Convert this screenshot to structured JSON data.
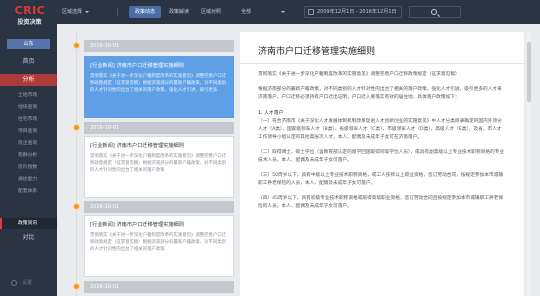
{
  "logo": {
    "brand": "CRIC",
    "subtitle": "投资决策"
  },
  "sidebar": {
    "region": "山东",
    "nav_home": "首页",
    "nav_analysis": "分析",
    "sub_items": [
      "土地市场",
      "地块查询",
      "住宅市场",
      "项目查询",
      "房企查询",
      "客群分析",
      "房价指数",
      "通达能力",
      "配套体系",
      "政策资讯"
    ],
    "active_sub": "政策资讯",
    "nav_compare": "对比",
    "settings": "设置"
  },
  "topbar": {
    "region_select": "区域选择",
    "tabs": [
      "政策动态",
      "政策解读",
      "区域对照"
    ],
    "active_tab": "政策动态",
    "all_select": "全部",
    "date_range": "2009年12月1日 - 2016年12月1日"
  },
  "list": {
    "items": [
      {
        "date": "2016-10-01",
        "title": "[行业新闻] 济南市户口迁移管理实施细则",
        "excerpt": "贯彻落实《关于进一步深化户籍制度改革的实施意见》调整完善户口迁移政策规定（征求意见稿）根据济南部分的最新户籍政策，对不同类别的人才针对性的出台了相关的落户政策，强化人才引进，吸引更多",
        "selected": true
      },
      {
        "date": "2016-10-01",
        "title": "[行业新闻] 济南市户口迁移管理实施细则",
        "excerpt": "贯彻落实《关于进一步深化户籍制度改革的实施意见》调整完善户口迁移政策规定（征求意见稿）根据济南部分的最新户籍政策，对不同类别的人才针对性的出台了相关的落户政策",
        "selected": false
      },
      {
        "date": "2016-10-01",
        "title": "[行业新闻] 济南市户口迁移管理实施细则",
        "excerpt": "贯彻落实《关于进一步深化户籍制度改革的实施意见》调整完善户口迁移政策规定（征求意见稿）根据济南部分的最新户籍政策，对不同类别的人才针对性的出台了相关的落户政策",
        "selected": false
      },
      {
        "date": "2016-10-01",
        "title": "",
        "excerpt": "",
        "selected": false
      }
    ]
  },
  "detail": {
    "title": "济南市户口迁移管理实施细则",
    "intro": "贯彻落实《关于进一步深化户籍制度改革的实施意见》调整完善户口迁移政策规定（征求意见稿）",
    "para1": "根据济南部分的最新户籍政策，对不同类别的人才针对性的出台了相关的落户政策，强化人才引进，吸引更多的人才来济南落户，户口迁移必须持有户口迁出证明，户口迁入要落实有效的居住地，具体落户政策如下：",
    "section1": "1. 人才落户",
    "item1": "（一）符合济南市《关于深化人才发展体制机制改革促进人才创新创业的实施意见》中人才分类目录确定的国内外顶尖人才（A类）、国家级领军人才（B类）、省级领军人才（C类）、市级领军人才（D类）、高级人才（E类），及省、市人才工作领导小组认定的其他高层次人才，本人、配偶及未成年子女可在济南落户。",
    "item2": "（二）取得博士、硕士学位（含教育部认定的留学回国取得同等学位人员），或具有副高级以上专业技术职称资格的专业技术人员，本人、配偶及未成年子女可落户。",
    "item3": "（三）50周岁以下，具有中级以上专业技术职称资格，或工人技师以上职业资格，签订劳动合同，按规定参加本市城镇职工养老保险的人员，本人、配偶及未成年子女可落户。",
    "item4": "（四）45周岁以下，具有初级专业技术职称资格或取得高级职业资格，签订劳动合同且按规定参加本市城镇职工养老保险的人员，本人、配偶及未成年子女可落户。"
  }
}
